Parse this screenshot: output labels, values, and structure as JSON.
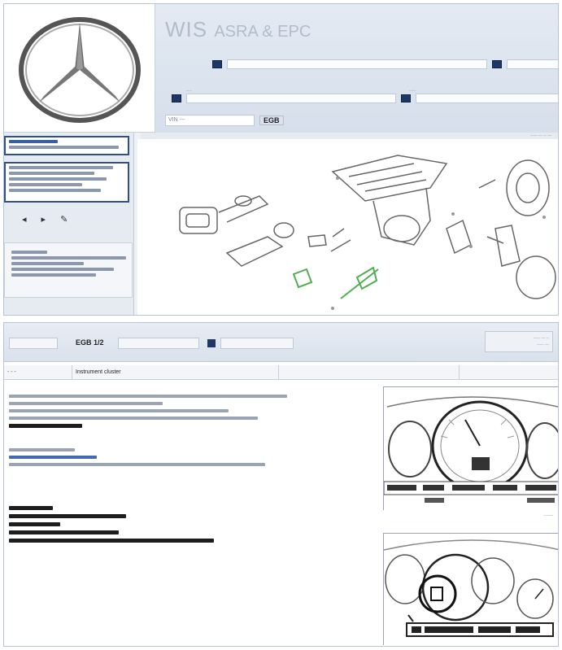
{
  "top_window": {
    "title": "WIS",
    "title_sub": "ASRA & EPC",
    "vin_field": "VIN  ---",
    "vin_button": "EGB",
    "tool_icons": [
      "◂",
      "▸",
      "✎"
    ],
    "diagram_header_right": "----- --- -- ---"
  },
  "bottom_window": {
    "toolbar_label": "EGB 1/2",
    "tab_value": "Instrument cluster",
    "tab_placeholder": "- - -",
    "right_box": "----- --- --\n----- ---"
  },
  "colors": {
    "accent_dark_blue": "#1d3766",
    "panel_bg": "#eef2f7",
    "highlight_green": "#4fae4f"
  }
}
